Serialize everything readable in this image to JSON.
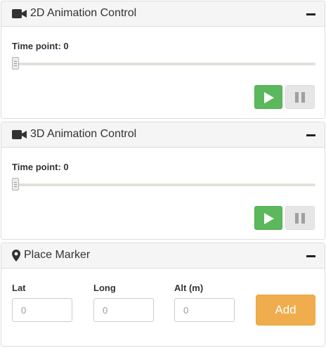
{
  "panels": [
    {
      "title": "2D Animation Control",
      "icon": "video-camera-icon",
      "time_label": "Time point: 0",
      "slider_value": 0,
      "play_icon": "play-icon",
      "pause_icon": "pause-icon"
    },
    {
      "title": "3D Animation Control",
      "icon": "video-camera-icon",
      "time_label": "Time point: 0",
      "slider_value": 0,
      "play_icon": "play-icon",
      "pause_icon": "pause-icon"
    }
  ],
  "marker": {
    "title": "Place Marker",
    "icon": "map-pin-icon",
    "fields": [
      {
        "label": "Lat",
        "placeholder": "0"
      },
      {
        "label": "Long",
        "placeholder": "0"
      },
      {
        "label": "Alt (m)",
        "placeholder": "0"
      }
    ],
    "add_label": "Add"
  },
  "colors": {
    "play": "#5cb85c",
    "pause": "#e6e6e6",
    "add": "#f0ad4e",
    "heading_bg": "#f5f5f5",
    "border": "#dddddd"
  }
}
